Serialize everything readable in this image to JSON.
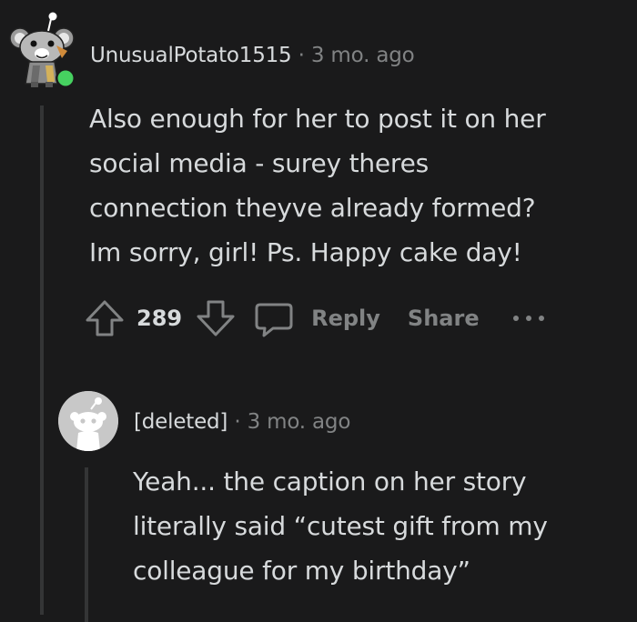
{
  "comment": {
    "username": "UnusualPotato1515",
    "separator": "·",
    "time": "3 mo. ago",
    "body_lines": [
      "Also enough for her to post it on her",
      "social media - surey theres",
      "connection theyve already formed?",
      "Im sorry, girl! Ps. Happy cake day!"
    ],
    "votes": "289",
    "reply_label": "Reply",
    "share_label": "Share",
    "online_color": "#46d160"
  },
  "reply": {
    "username": "[deleted]",
    "separator": "·",
    "time": "3 mo. ago",
    "body_lines": [
      "Yeah... the caption on her story",
      "literally said “cutest gift from my",
      "colleague for my birthday”"
    ]
  }
}
